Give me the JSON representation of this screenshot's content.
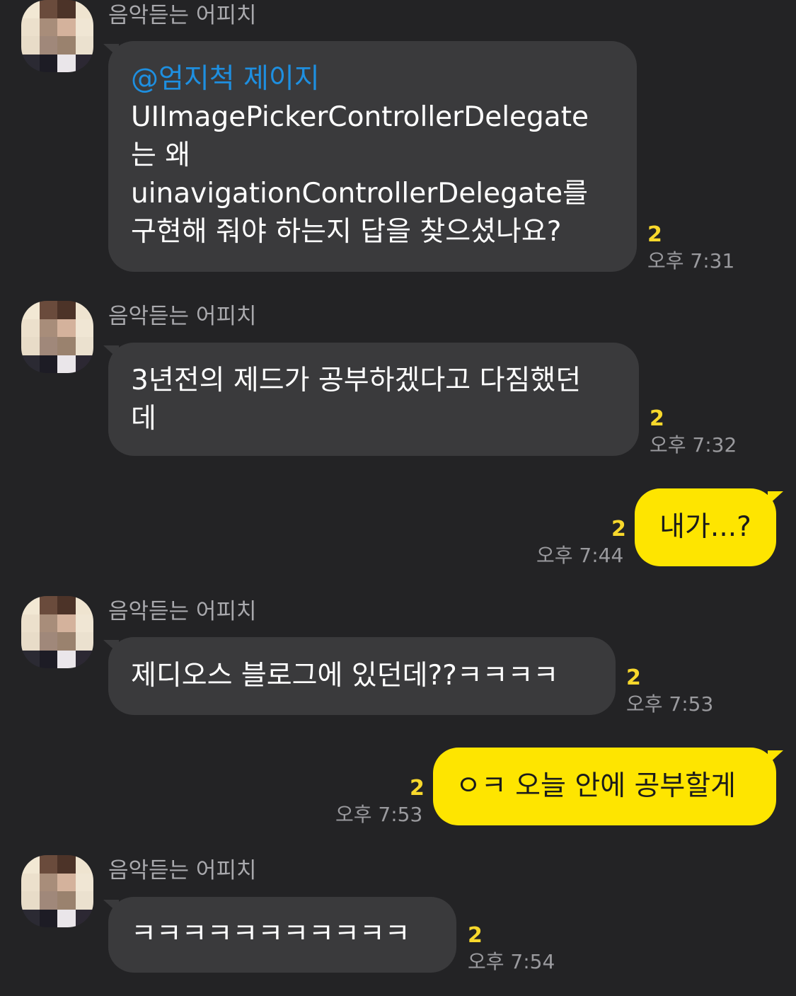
{
  "messages": [
    {
      "sender": "음악듣는 어피치",
      "mention": "@엄지척 제이지",
      "lines": [
        "UIImagePickerControllerDelegate",
        "는 왜",
        "uinavigationControllerDelegate를",
        "구현해 줘야 하는지 답을 찾으셨나요?"
      ],
      "unread": "2",
      "time": "오후 7:31"
    },
    {
      "sender": "음악듣는 어피치",
      "lines": [
        "3년전의 제드가 공부하겠다고 다짐했던",
        "데"
      ],
      "unread": "2",
      "time": "오후 7:32"
    },
    {
      "lines": [
        "내가...?"
      ],
      "unread": "2",
      "time": "오후 7:44"
    },
    {
      "sender": "음악듣는 어피치",
      "lines": [
        "제디오스 블로그에 있던데??ㅋㅋㅋㅋ"
      ],
      "unread": "2",
      "time": "오후 7:53"
    },
    {
      "lines": [
        "ㅇㅋ 오늘 안에 공부할게"
      ],
      "unread": "2",
      "time": "오후 7:53"
    },
    {
      "sender": "음악듣는 어피치",
      "lines": [
        "ㅋㅋㅋㅋㅋㅋㅋㅋㅋㅋㅋ"
      ],
      "unread": "2",
      "time": "오후 7:54"
    }
  ]
}
